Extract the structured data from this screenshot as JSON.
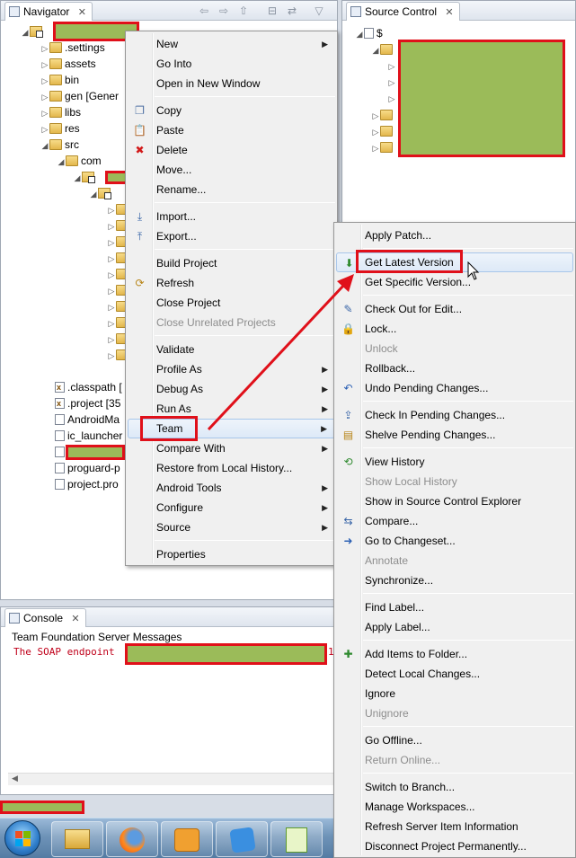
{
  "navigator": {
    "tab_label": "Navigator",
    "tab_close": "✕",
    "tree": {
      "settings": ".settings",
      "assets": "assets",
      "bin": "bin",
      "gen": "gen [Gener",
      "libs": "libs",
      "res": "res",
      "src": "src",
      "com": "com",
      "classpath": ".classpath [",
      "project": ".project [35",
      "manifest": "AndroidMa",
      "ic_launcher": "ic_launcher",
      "proguard": "proguard-p",
      "project_props": "project.pro"
    }
  },
  "source_control": {
    "tab_label": "Source Control",
    "tab_close": "✕",
    "root": "$"
  },
  "console": {
    "tab_label": "Console",
    "tab_close": "✕",
    "header": "Team Foundation Server Messages",
    "message": "The SOAP endpoint",
    "message_tail": "1"
  },
  "context_menu": {
    "items": [
      {
        "label": "New",
        "sub": true
      },
      {
        "label": "Go Into"
      },
      {
        "label": "Open in New Window"
      },
      {
        "label": "Copy",
        "icon": "copy-icon"
      },
      {
        "label": "Paste",
        "icon": "paste-icon"
      },
      {
        "label": "Delete",
        "icon": "delete-icon"
      },
      {
        "label": "Move..."
      },
      {
        "label": "Rename..."
      },
      {
        "label": "Import...",
        "icon": "import-icon"
      },
      {
        "label": "Export...",
        "icon": "export-icon"
      },
      {
        "label": "Build Project"
      },
      {
        "label": "Refresh",
        "icon": "refresh-icon"
      },
      {
        "label": "Close Project"
      },
      {
        "label": "Close Unrelated Projects",
        "disabled": true
      },
      {
        "label": "Validate"
      },
      {
        "label": "Profile As",
        "sub": true
      },
      {
        "label": "Debug As",
        "sub": true
      },
      {
        "label": "Run As",
        "sub": true
      },
      {
        "label": "Team",
        "sub": true
      },
      {
        "label": "Compare With",
        "sub": true
      },
      {
        "label": "Restore from Local History..."
      },
      {
        "label": "Android Tools",
        "sub": true
      },
      {
        "label": "Configure",
        "sub": true
      },
      {
        "label": "Source",
        "sub": true
      },
      {
        "label": "Properties"
      }
    ]
  },
  "team_menu": {
    "items": [
      {
        "label": "Apply Patch..."
      },
      {
        "label": "Get Latest Version",
        "icon": "get-latest-icon",
        "highlighted": true
      },
      {
        "label": "Get Specific Version..."
      },
      {
        "label": "Check Out for Edit...",
        "icon": "checkout-icon"
      },
      {
        "label": "Lock...",
        "icon": "lock-icon"
      },
      {
        "label": "Unlock",
        "disabled": true
      },
      {
        "label": "Rollback..."
      },
      {
        "label": "Undo Pending Changes...",
        "icon": "undo-icon"
      },
      {
        "label": "Check In Pending Changes...",
        "icon": "checkin-icon"
      },
      {
        "label": "Shelve Pending Changes...",
        "icon": "shelve-icon"
      },
      {
        "label": "View History",
        "icon": "history-icon"
      },
      {
        "label": "Show Local History",
        "disabled": true
      },
      {
        "label": "Show in Source Control Explorer"
      },
      {
        "label": "Compare...",
        "icon": "compare-icon"
      },
      {
        "label": "Go to Changeset...",
        "icon": "arrow-right-icon"
      },
      {
        "label": "Annotate",
        "disabled": true
      },
      {
        "label": "Synchronize..."
      },
      {
        "label": "Find Label..."
      },
      {
        "label": "Apply Label..."
      },
      {
        "label": "Add Items to Folder...",
        "icon": "add-items-icon"
      },
      {
        "label": "Detect Local Changes..."
      },
      {
        "label": "Ignore"
      },
      {
        "label": "Unignore",
        "disabled": true
      },
      {
        "label": "Go Offline..."
      },
      {
        "label": "Return Online...",
        "disabled": true
      },
      {
        "label": "Switch to Branch..."
      },
      {
        "label": "Manage Workspaces..."
      },
      {
        "label": "Refresh Server Item Information"
      },
      {
        "label": "Disconnect Project Permanently..."
      }
    ]
  },
  "taskbar": {
    "apps": [
      "start-orb",
      "file-explorer",
      "firefox",
      "outlook",
      "sticky-notes",
      "notepad-plus-plus"
    ]
  },
  "colors": {
    "redaction": "#9bbb59",
    "highlight_border": "#e0101a",
    "annotation_arrow": "#e0101a",
    "console_error_text": "#c0001a"
  }
}
